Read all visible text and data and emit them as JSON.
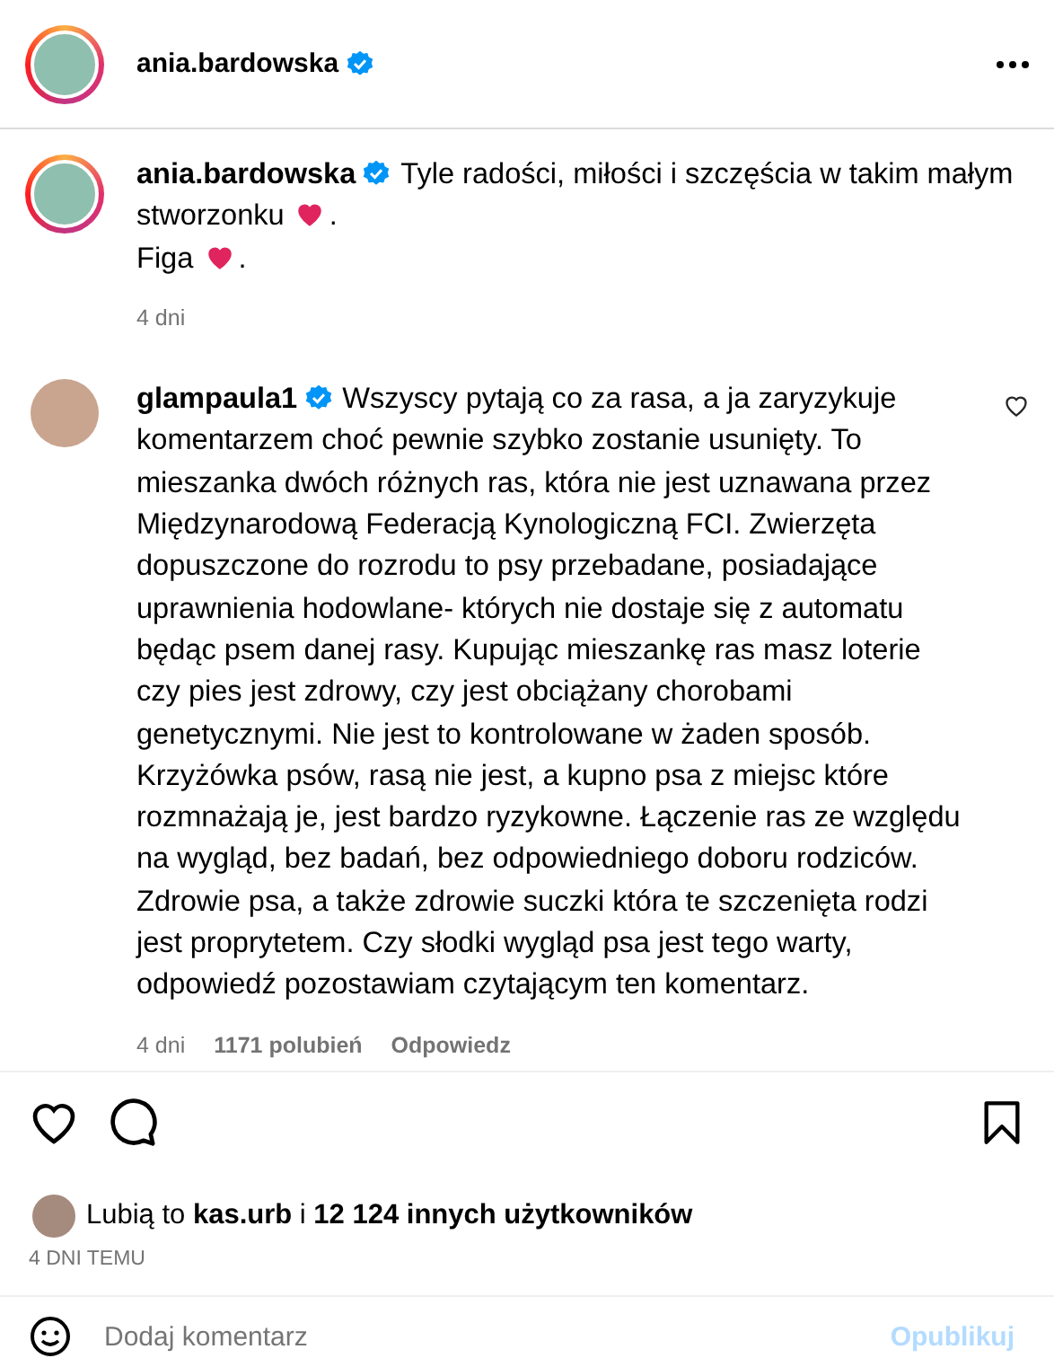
{
  "header": {
    "username": "ania.bardowska",
    "verified": true
  },
  "caption": {
    "username": "ania.bardowska",
    "verified": true,
    "lines": [
      {
        "text": "Tyle radości, miłości i szczęścia w takim małym stworzonku",
        "end": "."
      },
      {
        "text": "Figa",
        "end": "."
      }
    ],
    "time": "4 dni"
  },
  "comments": [
    {
      "username": "glampaula1",
      "verified": true,
      "liked": false,
      "text": "Wszyscy pytają co za rasa, a ja zaryzykuje komentarzem choć pewnie szybko zostanie usunięty. To mieszanka dwóch różnych ras, która nie jest uznawana przez Międzynarodową Federacją Kynologiczną FCI. Zwierzęta dopuszczone do rozrodu to psy przebadane, posiadające uprawnienia hodowlane- których nie dostaje się z automatu będąc psem danej rasy. Kupując mieszankę ras masz loterie czy pies jest zdrowy, czy jest obciążany chorobami genetycznymi. Nie jest to kontrolowane w żaden sposób. Krzyżówka psów, rasą nie jest, a kupno psa z miejsc które rozmnażają je, jest bardzo ryzykowne. Łączenie ras ze względu na wygląd, bez badań, bez odpowiedniego doboru rodziców. Zdrowie psa, a także zdrowie suczki która te szczenięta rodzi jest proprytetem. Czy słodki wygląd psa jest tego warty, odpowiedź pozostawiam czytającym ten komentarz.",
      "time": "4 dni",
      "likes": "1171 polubień",
      "reply": "Odpowiedz"
    }
  ],
  "actions": {
    "liked": false,
    "saved": false
  },
  "likes": {
    "text": "Lubią to **kas.urb** i **12 124 innych użytkowników**",
    "date": "4 DNI TEMU"
  },
  "comment_box": {
    "placeholder": "Dodaj komentarz",
    "post": "Opublikuj"
  }
}
